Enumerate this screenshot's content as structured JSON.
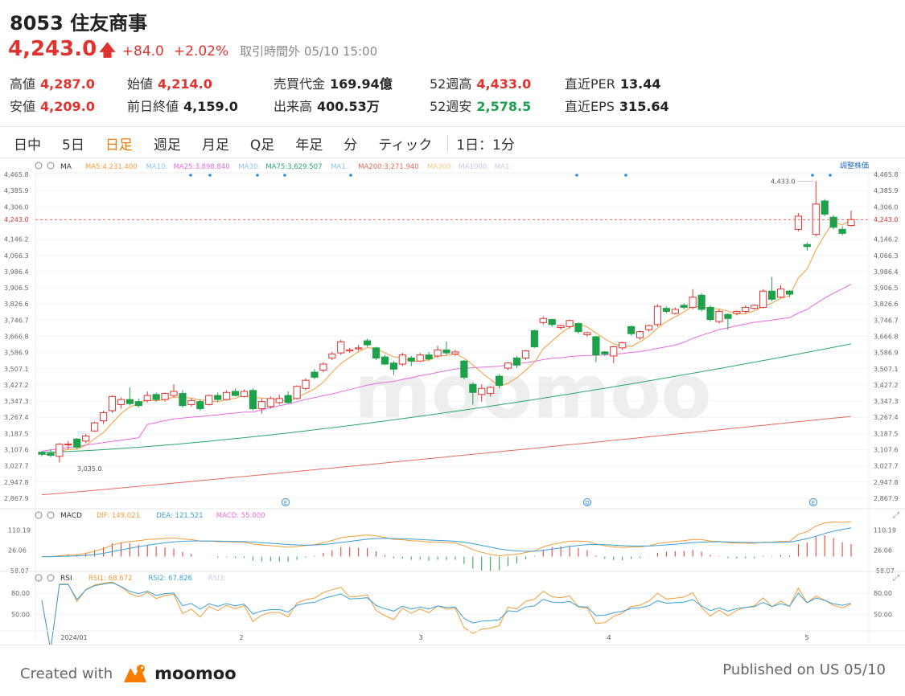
{
  "header": {
    "title": "8053 住友商事",
    "price": "4,243.0",
    "change": "+84.0",
    "change_pct": "+2.02%",
    "status": "取引時間外 05/10 15:00"
  },
  "stats": [
    {
      "label": "高値",
      "value": "4,287.0",
      "tone": "up"
    },
    {
      "label": "安値",
      "value": "4,209.0",
      "tone": "up"
    },
    {
      "label": "始値",
      "value": "4,214.0",
      "tone": "up"
    },
    {
      "label": "前日終値",
      "value": "4,159.0",
      "tone": "neutral"
    },
    {
      "label": "売買代金",
      "value": "169.94億",
      "tone": "neutral"
    },
    {
      "label": "出来高",
      "value": "400.53万",
      "tone": "neutral"
    },
    {
      "label": "52週高",
      "value": "4,433.0",
      "tone": "up"
    },
    {
      "label": "52週安",
      "value": "2,578.5",
      "tone": "down"
    },
    {
      "label": "直近PER",
      "value": "13.44",
      "tone": "neutral"
    },
    {
      "label": "直近EPS",
      "value": "315.64",
      "tone": "neutral"
    }
  ],
  "tabs": {
    "items": [
      "日中",
      "5日",
      "日足",
      "週足",
      "月足",
      "Q足",
      "年足",
      "分",
      "ティック"
    ],
    "active": "日足",
    "interval": "1日：1分"
  },
  "colors": {
    "up": "#e0332f",
    "down": "#1ea14b",
    "accent": "#f57c00",
    "ma5": "#f39c39",
    "ma25": "#e66be0",
    "ma75": "#2aa66a",
    "ma200": "#e86a5a",
    "dif": "#f39c39",
    "dea": "#3aa0d8",
    "rsi1": "#f39c39",
    "rsi2": "#3aa0d8"
  },
  "chart_data": [
    {
      "type": "candlestick",
      "indicator_label": "MA",
      "legend": [
        {
          "name": "MA5:",
          "value": "4,231.400",
          "color": "#f39c39"
        },
        {
          "name": "MA10:",
          "value": "",
          "color": "#8fc3ea"
        },
        {
          "name": "MA25:",
          "value": "3,898.840",
          "color": "#e66be0"
        },
        {
          "name": "MA30:",
          "value": "",
          "color": "#8fc3ea"
        },
        {
          "name": "MA75:",
          "value": "3,629.507",
          "color": "#2aa66a"
        },
        {
          "name": "MA1..",
          "value": "",
          "color": "#8fc3ea"
        },
        {
          "name": "MA200:",
          "value": "3,271.940",
          "color": "#e86a5a"
        },
        {
          "name": "MA300:",
          "value": "",
          "color": "#f3c98a"
        },
        {
          "name": "MA1000:",
          "value": "",
          "color": "#c8c8e8"
        },
        {
          "name": "MA1:",
          "value": "",
          "color": "#c8c8e8"
        }
      ],
      "adjust_label": "調整株価",
      "ylim": [
        2827.95,
        4505.75
      ],
      "y_ticks": [
        "4,465.8",
        "4,385.9",
        "4,306.0",
        "4,146.2",
        "4,066.3",
        "3,986.4",
        "3,906.5",
        "3,826.6",
        "3,746.7",
        "3,666.8",
        "3,586.9",
        "3,507.1",
        "3,427.2",
        "3,347.3",
        "3,267.4",
        "3,187.5",
        "3,107.6",
        "3,027.7",
        "2,947.8",
        "2,867.9"
      ],
      "current_price": 4243.0,
      "current_label": "4,243.0",
      "high_note": "4,433.0",
      "low_note": "3,035.0",
      "event_markers": [
        "E",
        "Q",
        "E"
      ],
      "candles": [
        {
          "o": 3095,
          "c": 3085,
          "h": 3100,
          "l": 3075
        },
        {
          "o": 3090,
          "c": 3080,
          "h": 3110,
          "l": 3070
        },
        {
          "o": 3075,
          "c": 3135,
          "h": 3140,
          "l": 3045
        },
        {
          "o": 3135,
          "c": 3135,
          "h": 3150,
          "l": 3110
        },
        {
          "o": 3160,
          "c": 3120,
          "h": 3165,
          "l": 3110
        },
        {
          "o": 3150,
          "c": 3175,
          "h": 3185,
          "l": 3140
        },
        {
          "o": 3200,
          "c": 3240,
          "h": 3245,
          "l": 3195
        },
        {
          "o": 3250,
          "c": 3290,
          "h": 3300,
          "l": 3235
        },
        {
          "o": 3300,
          "c": 3370,
          "h": 3375,
          "l": 3290
        },
        {
          "o": 3330,
          "c": 3355,
          "h": 3365,
          "l": 3310
        },
        {
          "o": 3355,
          "c": 3335,
          "h": 3415,
          "l": 3325
        },
        {
          "o": 3345,
          "c": 3325,
          "h": 3360,
          "l": 3315
        },
        {
          "o": 3350,
          "c": 3375,
          "h": 3395,
          "l": 3340
        },
        {
          "o": 3380,
          "c": 3355,
          "h": 3390,
          "l": 3345
        },
        {
          "o": 3355,
          "c": 3385,
          "h": 3390,
          "l": 3345
        },
        {
          "o": 3375,
          "c": 3395,
          "h": 3430,
          "l": 3365
        },
        {
          "o": 3385,
          "c": 3325,
          "h": 3400,
          "l": 3315
        },
        {
          "o": 3330,
          "c": 3350,
          "h": 3360,
          "l": 3320
        },
        {
          "o": 3345,
          "c": 3310,
          "h": 3355,
          "l": 3300
        },
        {
          "o": 3330,
          "c": 3375,
          "h": 3380,
          "l": 3325
        },
        {
          "o": 3375,
          "c": 3355,
          "h": 3390,
          "l": 3345
        },
        {
          "o": 3355,
          "c": 3390,
          "h": 3400,
          "l": 3350
        },
        {
          "o": 3395,
          "c": 3375,
          "h": 3410,
          "l": 3370
        },
        {
          "o": 3370,
          "c": 3395,
          "h": 3405,
          "l": 3365
        },
        {
          "o": 3400,
          "c": 3310,
          "h": 3410,
          "l": 3300
        },
        {
          "o": 3310,
          "c": 3345,
          "h": 3360,
          "l": 3285
        },
        {
          "o": 3320,
          "c": 3360,
          "h": 3370,
          "l": 3310
        },
        {
          "o": 3340,
          "c": 3360,
          "h": 3380,
          "l": 3330
        },
        {
          "o": 3375,
          "c": 3340,
          "h": 3395,
          "l": 3335
        },
        {
          "o": 3360,
          "c": 3420,
          "h": 3425,
          "l": 3355
        },
        {
          "o": 3410,
          "c": 3450,
          "h": 3460,
          "l": 3400
        },
        {
          "o": 3490,
          "c": 3465,
          "h": 3505,
          "l": 3455
        },
        {
          "o": 3500,
          "c": 3530,
          "h": 3540,
          "l": 3490
        },
        {
          "o": 3560,
          "c": 3580,
          "h": 3590,
          "l": 3550
        },
        {
          "o": 3585,
          "c": 3640,
          "h": 3650,
          "l": 3575
        },
        {
          "o": 3595,
          "c": 3600,
          "h": 3610,
          "l": 3585
        },
        {
          "o": 3605,
          "c": 3610,
          "h": 3625,
          "l": 3595
        },
        {
          "o": 3645,
          "c": 3625,
          "h": 3655,
          "l": 3615
        },
        {
          "o": 3610,
          "c": 3560,
          "h": 3615,
          "l": 3550
        },
        {
          "o": 3565,
          "c": 3530,
          "h": 3575,
          "l": 3525
        },
        {
          "o": 3535,
          "c": 3505,
          "h": 3545,
          "l": 3475
        },
        {
          "o": 3530,
          "c": 3575,
          "h": 3585,
          "l": 3520
        },
        {
          "o": 3560,
          "c": 3545,
          "h": 3570,
          "l": 3520
        },
        {
          "o": 3545,
          "c": 3575,
          "h": 3585,
          "l": 3540
        },
        {
          "o": 3575,
          "c": 3555,
          "h": 3590,
          "l": 3545
        },
        {
          "o": 3570,
          "c": 3600,
          "h": 3620,
          "l": 3560
        },
        {
          "o": 3600,
          "c": 3585,
          "h": 3640,
          "l": 3575
        },
        {
          "o": 3580,
          "c": 3590,
          "h": 3600,
          "l": 3570
        },
        {
          "o": 3545,
          "c": 3465,
          "h": 3550,
          "l": 3455
        },
        {
          "o": 3430,
          "c": 3390,
          "h": 3440,
          "l": 3330
        },
        {
          "o": 3380,
          "c": 3410,
          "h": 3430,
          "l": 3345
        },
        {
          "o": 3385,
          "c": 3415,
          "h": 3420,
          "l": 3370
        },
        {
          "o": 3470,
          "c": 3425,
          "h": 3480,
          "l": 3410
        },
        {
          "o": 3510,
          "c": 3535,
          "h": 3540,
          "l": 3500
        },
        {
          "o": 3560,
          "c": 3525,
          "h": 3570,
          "l": 3510
        },
        {
          "o": 3560,
          "c": 3595,
          "h": 3600,
          "l": 3550
        },
        {
          "o": 3695,
          "c": 3615,
          "h": 3700,
          "l": 3610
        },
        {
          "o": 3735,
          "c": 3755,
          "h": 3765,
          "l": 3725
        },
        {
          "o": 3750,
          "c": 3725,
          "h": 3755,
          "l": 3715
        },
        {
          "o": 3710,
          "c": 3720,
          "h": 3725,
          "l": 3700
        },
        {
          "o": 3715,
          "c": 3745,
          "h": 3750,
          "l": 3705
        },
        {
          "o": 3730,
          "c": 3690,
          "h": 3735,
          "l": 3680
        },
        {
          "o": 3675,
          "c": 3685,
          "h": 3690,
          "l": 3665
        },
        {
          "o": 3665,
          "c": 3575,
          "h": 3670,
          "l": 3540
        },
        {
          "o": 3590,
          "c": 3580,
          "h": 3595,
          "l": 3570
        },
        {
          "o": 3570,
          "c": 3615,
          "h": 3620,
          "l": 3535
        },
        {
          "o": 3610,
          "c": 3635,
          "h": 3640,
          "l": 3600
        },
        {
          "o": 3715,
          "c": 3680,
          "h": 3720,
          "l": 3670
        },
        {
          "o": 3660,
          "c": 3690,
          "h": 3695,
          "l": 3650
        },
        {
          "o": 3700,
          "c": 3720,
          "h": 3725,
          "l": 3690
        },
        {
          "o": 3725,
          "c": 3815,
          "h": 3825,
          "l": 3715
        },
        {
          "o": 3805,
          "c": 3790,
          "h": 3815,
          "l": 3780
        },
        {
          "o": 3780,
          "c": 3800,
          "h": 3810,
          "l": 3775
        },
        {
          "o": 3820,
          "c": 3810,
          "h": 3830,
          "l": 3800
        },
        {
          "o": 3810,
          "c": 3860,
          "h": 3900,
          "l": 3800
        },
        {
          "o": 3870,
          "c": 3800,
          "h": 3880,
          "l": 3790
        },
        {
          "o": 3810,
          "c": 3750,
          "h": 3820,
          "l": 3740
        },
        {
          "o": 3740,
          "c": 3790,
          "h": 3800,
          "l": 3730
        },
        {
          "o": 3775,
          "c": 3755,
          "h": 3780,
          "l": 3700
        },
        {
          "o": 3780,
          "c": 3790,
          "h": 3795,
          "l": 3770
        },
        {
          "o": 3790,
          "c": 3810,
          "h": 3820,
          "l": 3780
        },
        {
          "o": 3805,
          "c": 3820,
          "h": 3825,
          "l": 3800
        },
        {
          "o": 3810,
          "c": 3890,
          "h": 3900,
          "l": 3805
        },
        {
          "o": 3890,
          "c": 3850,
          "h": 3960,
          "l": 3840
        },
        {
          "o": 3860,
          "c": 3900,
          "h": 3920,
          "l": 3855
        },
        {
          "o": 3890,
          "c": 3875,
          "h": 3895,
          "l": 3860
        },
        {
          "o": 4195,
          "c": 4260,
          "h": 4275,
          "l": 4185
        },
        {
          "o": 4120,
          "c": 4110,
          "h": 4130,
          "l": 4090
        },
        {
          "o": 4170,
          "c": 4320,
          "h": 4433,
          "l": 4160
        },
        {
          "o": 4335,
          "c": 4270,
          "h": 4345,
          "l": 4260
        },
        {
          "o": 4255,
          "c": 4205,
          "h": 4265,
          "l": 4195
        },
        {
          "o": 4195,
          "c": 4175,
          "h": 4210,
          "l": 4165
        },
        {
          "o": 4214,
          "c": 4243,
          "h": 4287,
          "l": 4209
        }
      ],
      "ma5_end": 4231.4,
      "ma25_end": 3898.84,
      "ma75_end": 3629.507,
      "ma200_end": 3271.94,
      "x_labels": [
        "2024/01",
        "2",
        "3",
        "4",
        "5"
      ]
    },
    {
      "type": "bar",
      "name": "MACD",
      "legend": [
        {
          "name": "DIF:",
          "value": "149.021",
          "color": "#f39c39"
        },
        {
          "name": "DEA:",
          "value": "121.521",
          "color": "#3aa0d8"
        },
        {
          "name": "MACD:",
          "value": "55.000",
          "color": "#e66be0"
        }
      ],
      "y_ticks": [
        "110.19",
        "26.06",
        "-58.07"
      ],
      "ylim": [
        -58.07,
        145
      ]
    },
    {
      "type": "line",
      "name": "RSI",
      "legend": [
        {
          "name": "RSI1:",
          "value": "68.672",
          "color": "#f39c39"
        },
        {
          "name": "RSI2:",
          "value": "67.826",
          "color": "#3aa0d8"
        },
        {
          "name": "RSI3:",
          "value": "",
          "color": "#c8c8e8"
        }
      ],
      "y_ticks": [
        "80.00",
        "50.00"
      ],
      "ylim": [
        30,
        95
      ]
    }
  ],
  "watermark": "moomoo",
  "footer": {
    "created": "Created with",
    "logo": "moomoo",
    "published": "Published on US 05/10"
  }
}
